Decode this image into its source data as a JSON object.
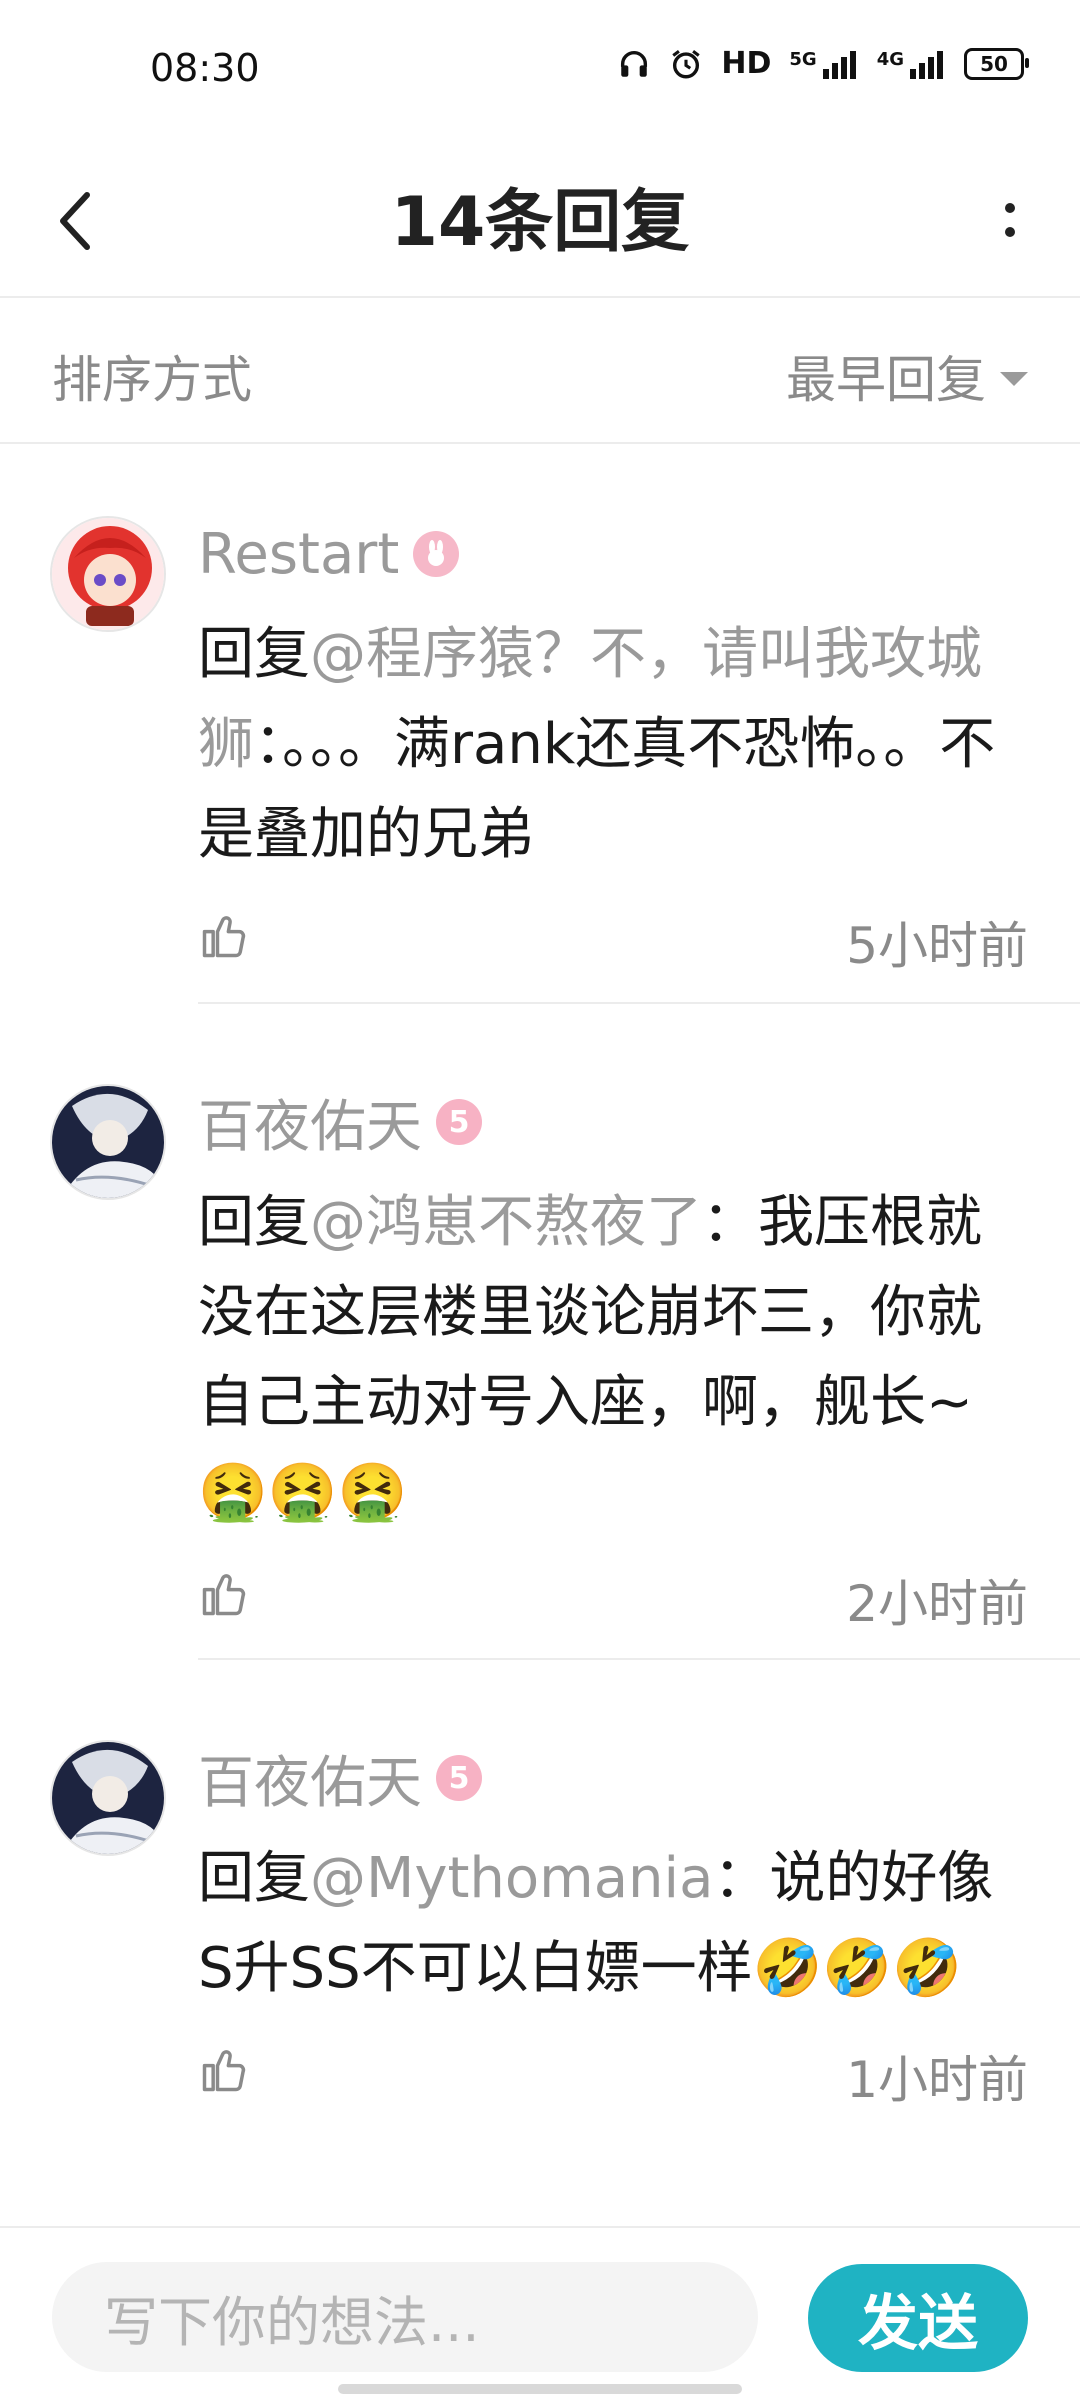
{
  "status": {
    "time": "08:30",
    "hd": "HD",
    "net1": "5G",
    "net2": "4G",
    "battery": "50"
  },
  "header": {
    "title": "14条回复"
  },
  "sort": {
    "label": "排序方式",
    "value": "最早回复"
  },
  "comments": [
    {
      "name": "Restart",
      "badge": "",
      "prefix": "回复",
      "mention": "@程序猿？不，请叫我攻城狮",
      "text": "：。。。满rank还真不恐怖。。不是叠加的兄弟",
      "time": "5小时前"
    },
    {
      "name": "百夜佑天",
      "badge": "5",
      "prefix": "回复",
      "mention": "@鸿崽不熬夜了",
      "text": "：我压根就没在这层楼里谈论崩坏三，你就自己主动对号入座，啊，舰长~🤮🤮🤮",
      "time": "2小时前"
    },
    {
      "name": "百夜佑天",
      "badge": "5",
      "prefix": "回复",
      "mention": "@Mythomania",
      "text": "：说的好像S升SS不可以白嫖一样🤣🤣🤣",
      "time": "1小时前"
    }
  ],
  "composer": {
    "placeholder": "写下你的想法...",
    "send_label": "发送"
  },
  "colors": {
    "accent": "#1fb3c3",
    "muted_text": "#9a9a9a",
    "divider": "#ececec"
  }
}
